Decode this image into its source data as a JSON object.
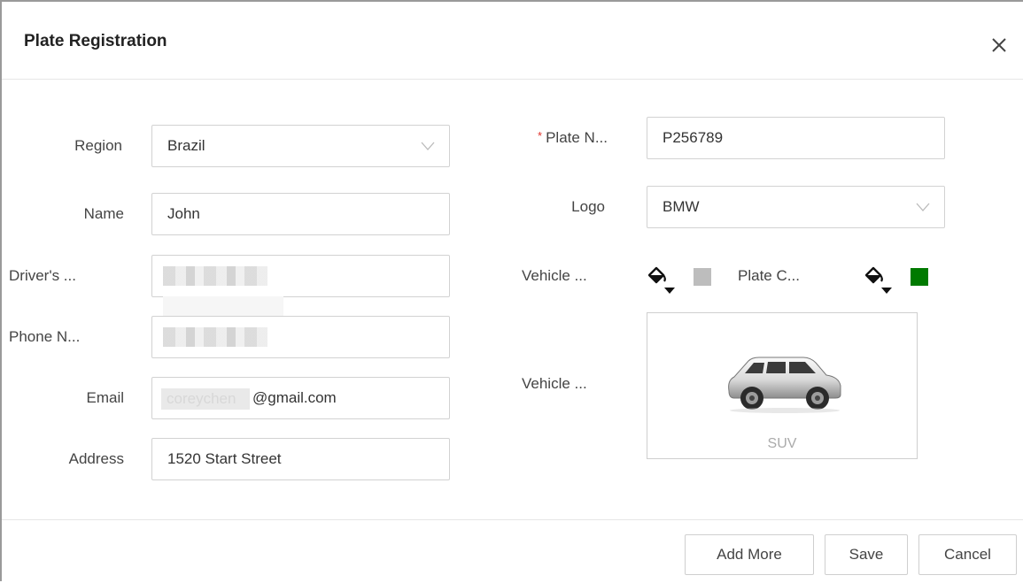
{
  "dialog": {
    "title": "Plate Registration",
    "close_glyph": "X"
  },
  "form": {
    "region": {
      "label": "Region",
      "value": "Brazil"
    },
    "name": {
      "label": "Name",
      "value": "John"
    },
    "drivers_license": {
      "label": "Driver's ...",
      "value": ""
    },
    "phone": {
      "label": "Phone N...",
      "value": ""
    },
    "email": {
      "label": "Email",
      "value_redacted": "coreychen",
      "value_suffix": "@gmail.com"
    },
    "address": {
      "label": "Address",
      "value": "1520 Start Street"
    },
    "plate_no": {
      "required_mark": "*",
      "label": "Plate N...",
      "value": "P256789"
    },
    "logo": {
      "label": "Logo",
      "value": "BMW"
    },
    "vehicle_color": {
      "label": "Vehicle ...",
      "color": "#bdbdbd"
    },
    "plate_color": {
      "label": "Plate C...",
      "color": "#007a00"
    },
    "vehicle_type": {
      "label": "Vehicle ...",
      "value": "SUV"
    }
  },
  "footer": {
    "add_more": "Add More",
    "save": "Save",
    "cancel": "Cancel"
  },
  "icons": {
    "close": "close-icon",
    "dropdown": "chevron-down-icon",
    "fill": "paint-bucket-icon",
    "vehicle": "suv-car-icon"
  }
}
